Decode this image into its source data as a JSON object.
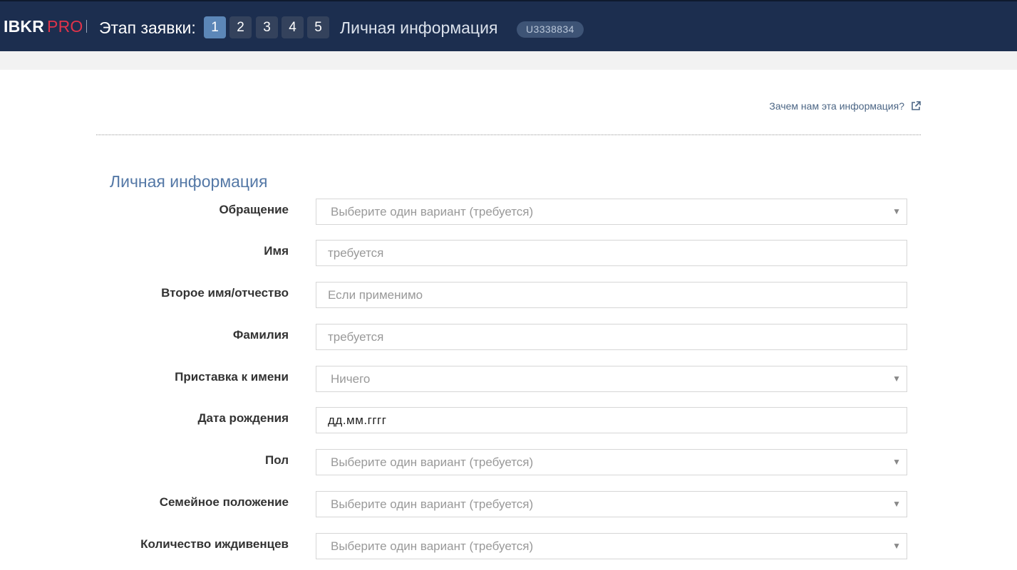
{
  "header": {
    "brand_main": "IBKR",
    "brand_pro": "PRO",
    "stage_label": "Этап заявки:",
    "steps": [
      "1",
      "2",
      "3",
      "4",
      "5"
    ],
    "active_step": "1",
    "step_title": "Личная информация",
    "account_id": "U3338834"
  },
  "info_link": {
    "label": "Зачем нам эта информация?",
    "icon": "external-link-icon"
  },
  "section": {
    "title": "Личная информация"
  },
  "form": {
    "salutation": {
      "label": "Обращение",
      "value": "Выберите один вариант (требуется)"
    },
    "first_name": {
      "label": "Имя",
      "placeholder": "требуется"
    },
    "middle_name": {
      "label": "Второе имя/отчество",
      "placeholder": "Если применимо"
    },
    "last_name": {
      "label": "Фамилия",
      "placeholder": "требуется"
    },
    "name_suffix": {
      "label": "Приставка к имени",
      "value": "Ничего"
    },
    "birth_date": {
      "label": "Дата рождения",
      "value": "дд.мм.гггг"
    },
    "gender": {
      "label": "Пол",
      "value": "Выберите один вариант (требуется)"
    },
    "marital_status": {
      "label": "Семейное положение",
      "value": "Выберите один вариант (требуется)"
    },
    "dependents": {
      "label": "Количество иждивенцев",
      "value": "Выберите один вариант (требуется)"
    }
  },
  "colors": {
    "header_bg": "#1c2e4f",
    "brand_accent": "#e0334a",
    "active_step": "#5c87b8",
    "section_title": "#5478a6"
  }
}
